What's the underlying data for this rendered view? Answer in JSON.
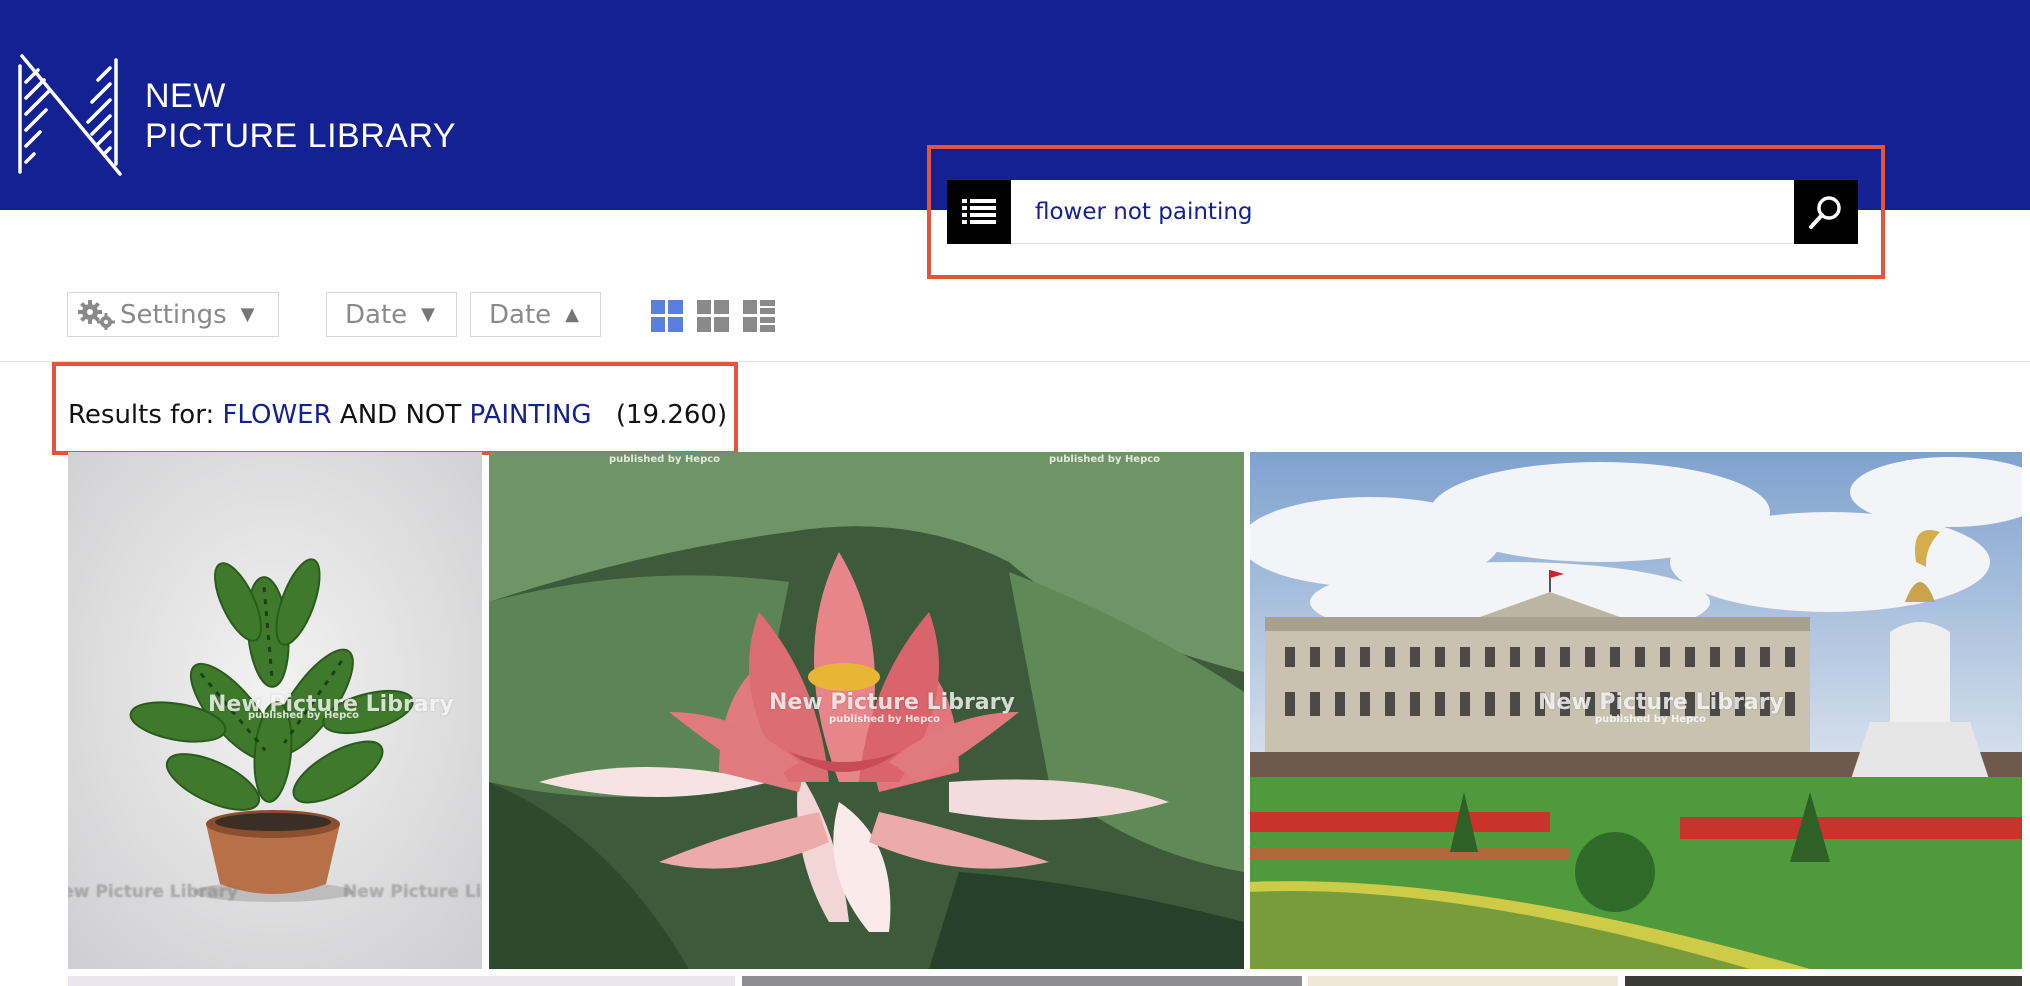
{
  "header": {
    "logo_line1": "NEW",
    "logo_line2": "PICTURE LIBRARY",
    "background_color": "#132192"
  },
  "search": {
    "menu_icon": "list-icon",
    "value": "flower not painting",
    "submit_icon": "search-icon"
  },
  "toolbar": {
    "settings_label": "Settings",
    "date_sort_desc_label": "Date",
    "date_sort_asc_label": "Date",
    "view_options": [
      "grid-large-icon",
      "grid-small-icon",
      "list-view-icon"
    ]
  },
  "results": {
    "prefix": "Results for:",
    "term1": "FLOWER",
    "operator": "AND NOT",
    "term2": "PAINTING",
    "count": "(19.260)"
  },
  "images": [
    {
      "subject": "potted plant",
      "watermark": "New Picture Library",
      "watermark_sub": "published by Hepco"
    },
    {
      "subject": "water lily",
      "watermark": "New Picture Library",
      "watermark_sub": "published by Hepco"
    },
    {
      "subject": "Buckingham Palace",
      "watermark": "New Picture Library",
      "watermark_sub": "published by Hepco"
    }
  ],
  "highlight_color": "#e5543a"
}
